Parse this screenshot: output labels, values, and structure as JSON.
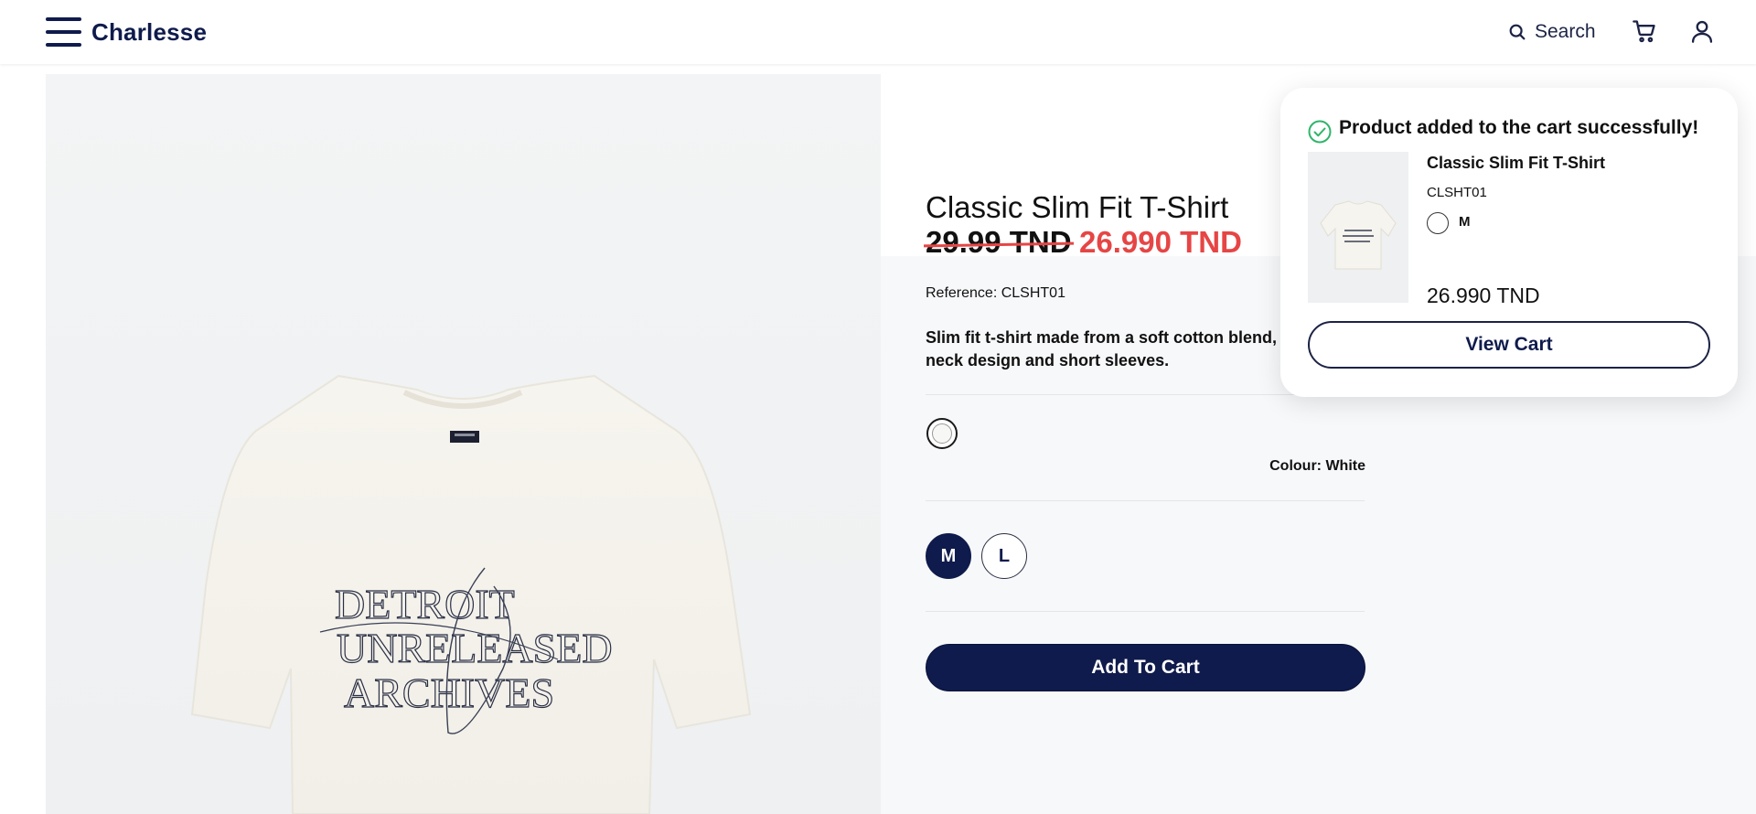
{
  "header": {
    "brand": "Charlesse",
    "search_label": "Search"
  },
  "product": {
    "title": "Classic Slim Fit T-Shirt",
    "old_price": "29.99 TND",
    "new_price": "26.990 TND",
    "reference": "Reference: CLSHT01",
    "description": "Slim fit t-shirt made from a soft cotton blend, f classic crew neck design and short sleeves.",
    "colour_label": "Colour: White",
    "sizes": [
      "M",
      "L"
    ],
    "selected_size": "M",
    "add_to_cart_label": "Add To Cart",
    "graphic_text": [
      "DETROIT",
      "UNRELEASED",
      "ARCHIVES"
    ]
  },
  "toast": {
    "message": "Product added to the cart successfully!",
    "product_name": "Classic Slim Fit T-Shirt",
    "reference": "CLSHT01",
    "size": "M",
    "price": "26.990 TND",
    "view_cart_label": "View Cart"
  },
  "colors": {
    "brand_navy": "#0f1b4c",
    "sale_red": "#e64545",
    "success_green": "#2fb56a"
  }
}
